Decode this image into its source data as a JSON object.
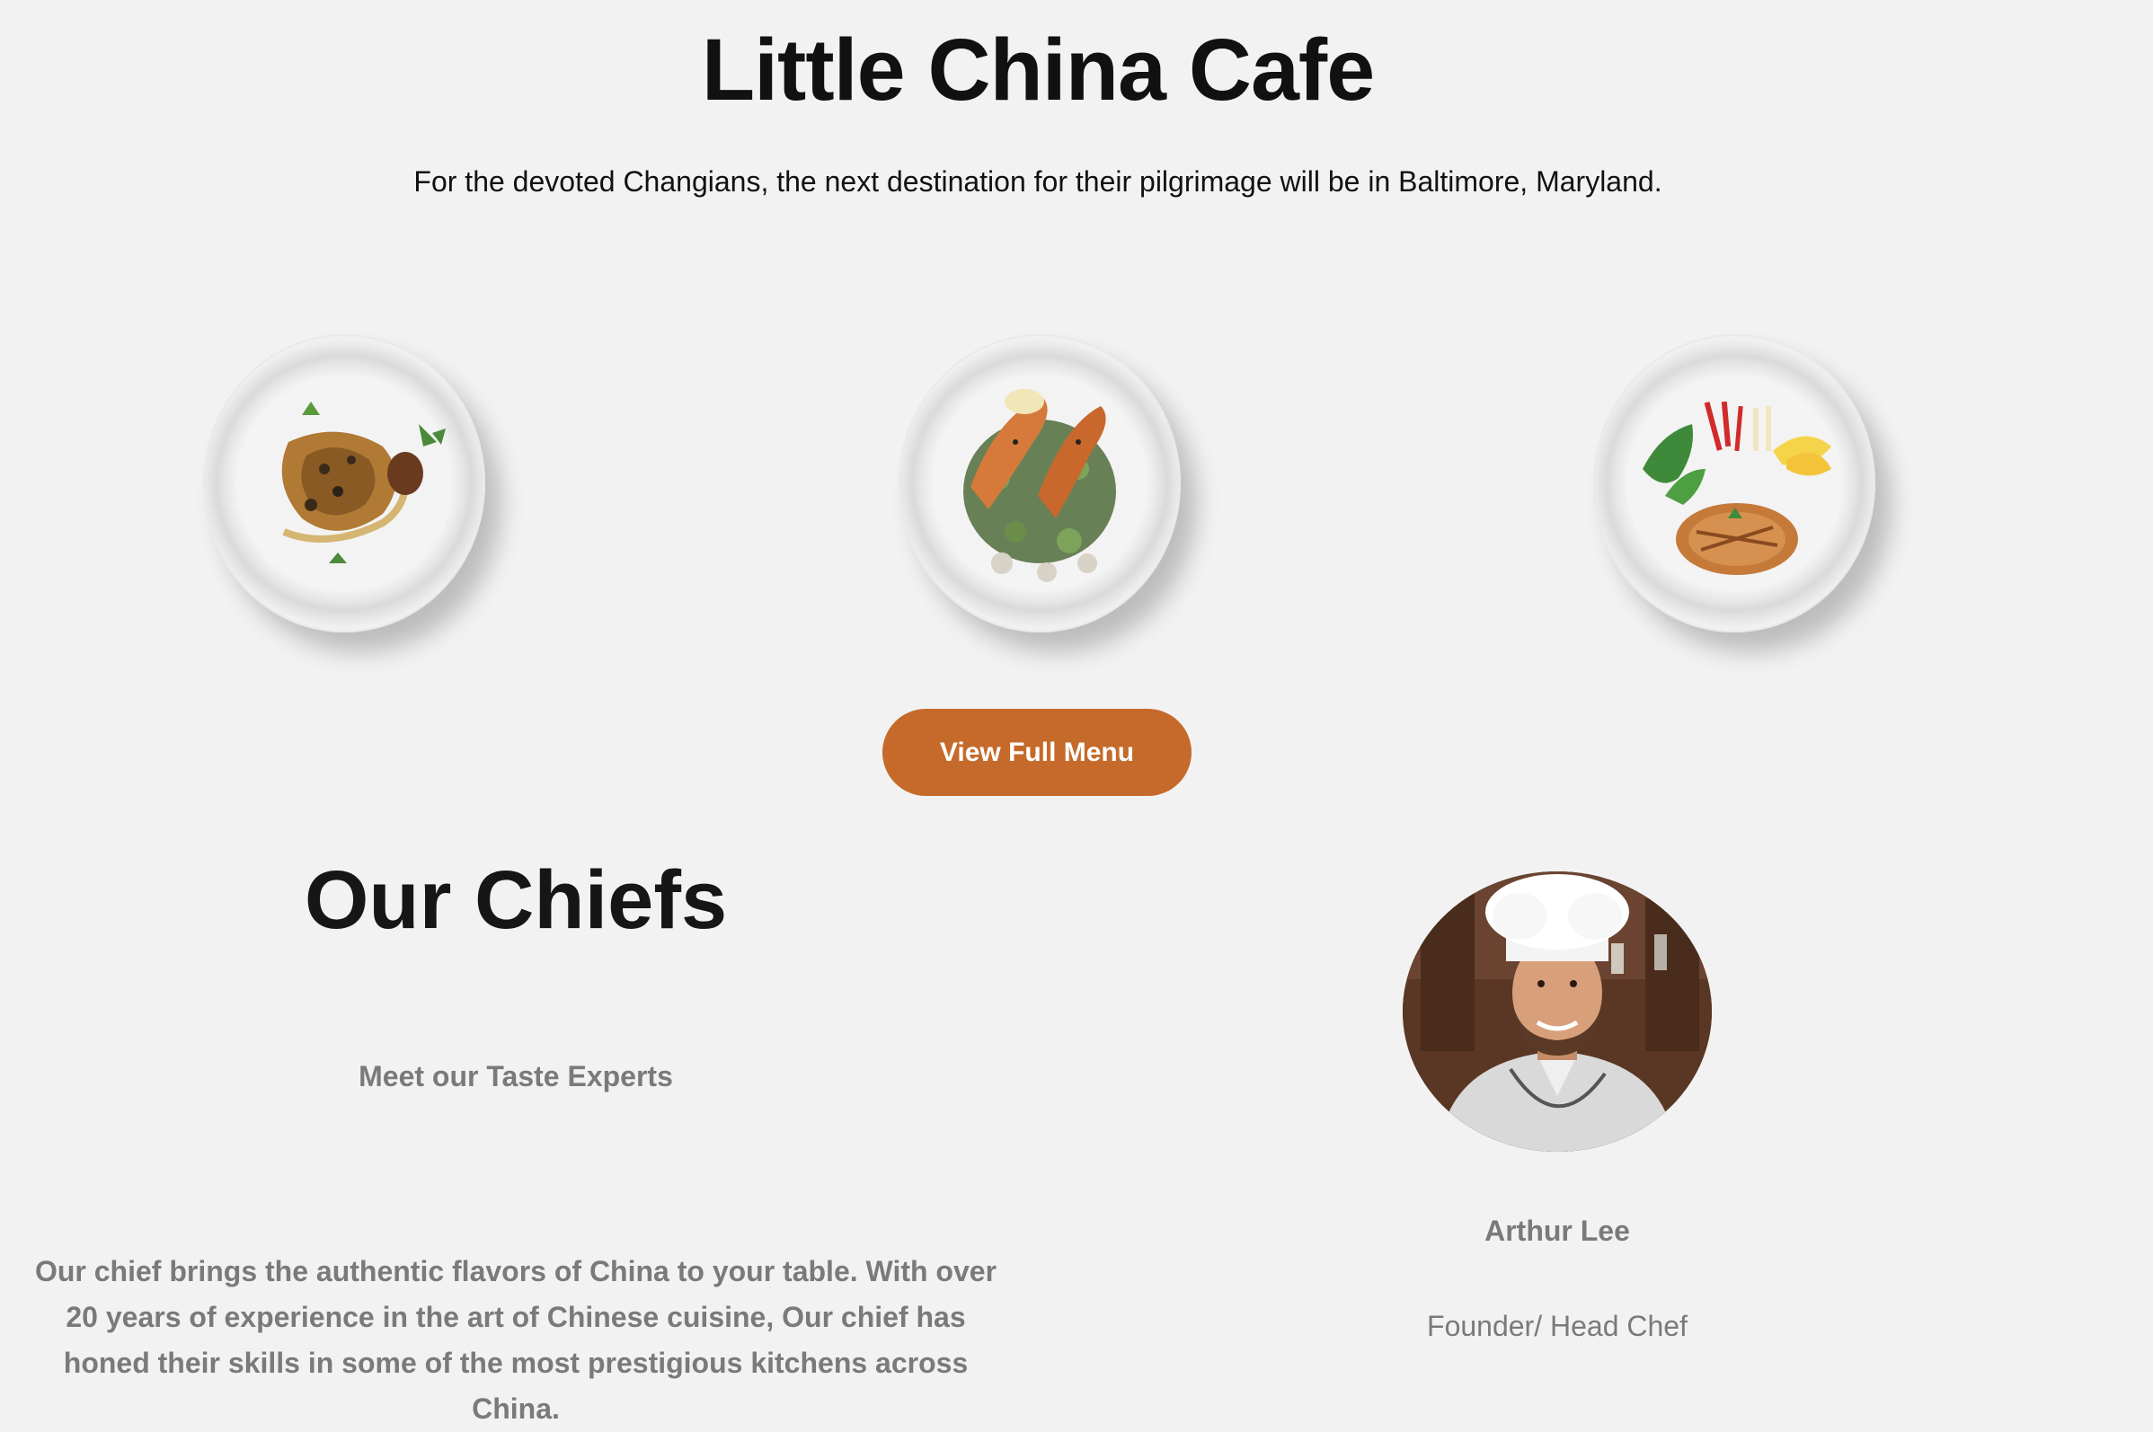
{
  "header": {
    "title": "Little China Cafe",
    "tagline": "For the devoted Changians, the next destination for their pilgrimage will be in Baltimore, Maryland."
  },
  "dishes": [
    {
      "icon": "plated-dish-image"
    },
    {
      "icon": "salmon-salad-image"
    },
    {
      "icon": "grilled-fish-image"
    }
  ],
  "menu": {
    "button_label": "View Full Menu",
    "button_color": "#c56a2a"
  },
  "chefs": {
    "title": "Our Chiefs",
    "subtitle": "Meet our Taste Experts",
    "description": "Our chief brings the authentic flavors of China to your table. With over 20 years of experience in the art of Chinese cuisine, Our chief has honed their skills in some of the most prestigious kitchens across China.",
    "featured": {
      "name": "Arthur Lee",
      "role": "Founder/ Head Chef"
    }
  },
  "colors": {
    "background": "#f2f2f2",
    "heading": "#111111",
    "muted_text": "#7a7a7a",
    "accent": "#c56a2a"
  }
}
